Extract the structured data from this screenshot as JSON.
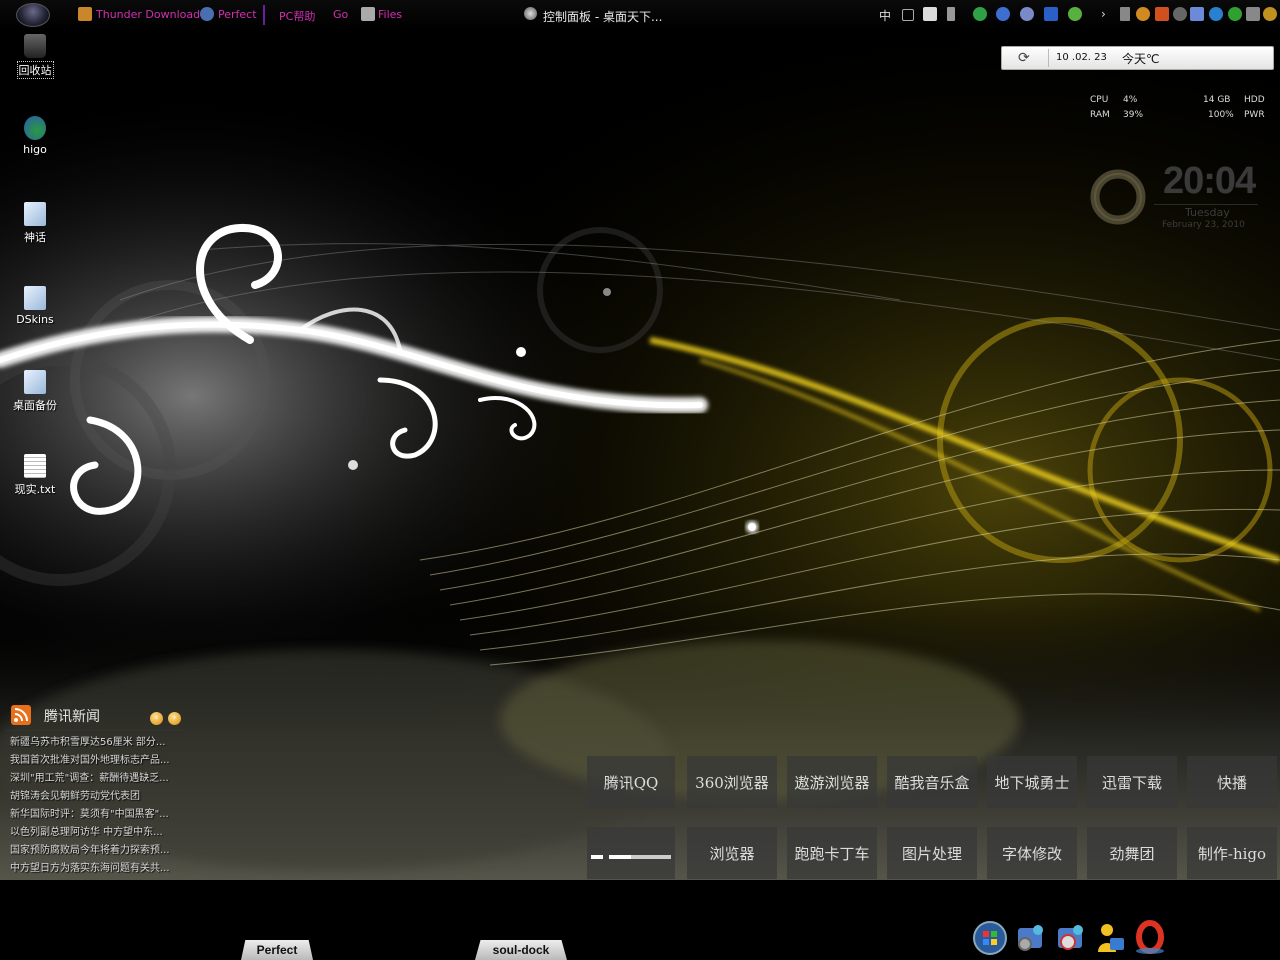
{
  "taskbar": {
    "quick_launch": [
      {
        "label": "Thunder Download",
        "icon": "thunder-icon"
      },
      {
        "label": "Perfect",
        "icon": "perfect-icon"
      },
      {
        "label": "PC帮助",
        "icon": null
      },
      {
        "label": "Go",
        "icon": null
      },
      {
        "label": "Files",
        "icon": "files-icon"
      }
    ],
    "window_title": "控制面板 - 桌面天下...",
    "tray": {
      "ime": "中",
      "icons": [
        "volume-icon",
        "network-icon",
        "qq-icon",
        "antivirus-icon",
        "thunder-tray-icon",
        "browser-tray-icon",
        "weather-tray-icon",
        "flash-icon"
      ]
    }
  },
  "desktop_icons": [
    {
      "label": "回收站",
      "icon": "recycle-bin-icon"
    },
    {
      "label": "higo",
      "icon": "network-user-icon"
    },
    {
      "label": "神话",
      "icon": "shortcut-icon"
    },
    {
      "label": "DSkins",
      "icon": "shortcut-icon"
    },
    {
      "label": "桌面备份",
      "icon": "shortcut-icon"
    },
    {
      "label": "现实.txt",
      "icon": "text-file-icon"
    }
  ],
  "weather": {
    "date": "10 .02. 23",
    "text": "今天℃"
  },
  "system": {
    "cpu_label": "CPU",
    "cpu": "4%",
    "ram_label": "RAM",
    "ram": "39%",
    "disk": "14 GB",
    "disk_label": "HDD",
    "power": "100%",
    "power_label": "PWR"
  },
  "clock": {
    "time": "20:04",
    "day": "Tuesday",
    "date": "February 23, 2010"
  },
  "news": {
    "title": "腾讯新闻",
    "items": [
      "新疆乌苏市积雪厚达56厘米 部分...",
      "我国首次批准对国外地理标志产品...",
      "深圳\"用工荒\"调查：薪酬待遇缺乏...",
      "胡锦涛会见朝鲜劳动党代表团",
      "新华国际时评：莫须有\"中国黑客\"...",
      "以色列副总理阿访华 中方望中东...",
      "国家预防腐败局今年将着力探索预...",
      "中方望日方为落实东海问题有关共..."
    ]
  },
  "launcher": {
    "row1": [
      "腾讯QQ",
      "360浏览器",
      "遨游浏览器",
      "酷我音乐盒",
      "地下城勇士",
      "迅雷下载",
      "快播"
    ],
    "row2": [
      "",
      "浏览器",
      "跑跑卡丁车",
      "图片处理",
      "字体修改",
      "劲舞团",
      "制作-higo"
    ]
  },
  "dock": {
    "tabs": [
      "Perfect",
      "soul-dock"
    ],
    "icons": [
      "windows-orb-icon",
      "control-panel-icon",
      "network-settings-icon",
      "user-icon",
      "opera-icon"
    ]
  }
}
